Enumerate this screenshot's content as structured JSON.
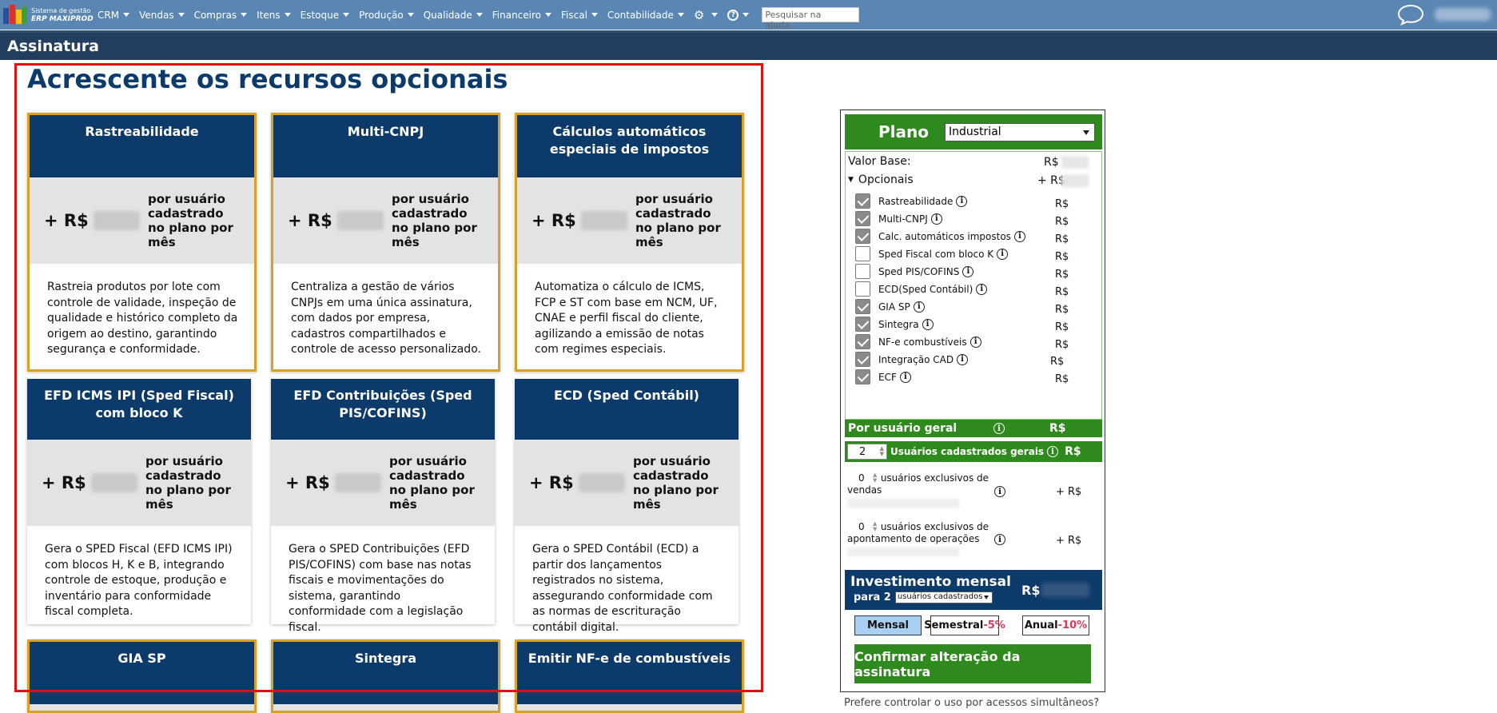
{
  "app": {
    "logo_line1": "Sistema de gestão",
    "logo_line2": "ERP MAXIPROD",
    "nav": [
      "CRM",
      "Vendas",
      "Compras",
      "Itens",
      "Estoque",
      "Produção",
      "Qualidade",
      "Financeiro",
      "Fiscal",
      "Contabilidade"
    ],
    "search_placeholder": "Pesquisar na ajuda..."
  },
  "page": {
    "title": "Assinatura",
    "section_title": "Acrescente os recursos opcionais"
  },
  "cards": [
    {
      "title": "Rastreabilidade",
      "price_prefix": "+ R$",
      "unit": "por usuário cadastrado no plano por mês",
      "desc": "Rastreia produtos por lote com controle de validade, inspeção de qualidade e histórico completo da origem ao destino, garantindo segurança e conformidade.",
      "selected": true
    },
    {
      "title": "Multi-CNPJ",
      "price_prefix": "+ R$",
      "unit": "por usuário cadastrado no plano por mês",
      "desc": "Centraliza a gestão de vários CNPJs em uma única assinatura, com dados por empresa, cadastros compartilhados e controle de acesso personalizado.",
      "selected": true
    },
    {
      "title": "Cálculos automáticos especiais de impostos",
      "price_prefix": "+ R$",
      "unit": "por usuário cadastrado no plano por mês",
      "desc": "Automatiza o cálculo de ICMS, FCP e ST com base em NCM, UF, CNAE e perfil fiscal do cliente, agilizando a emissão de notas com regimes especiais.",
      "selected": true
    },
    {
      "title": "EFD ICMS IPI (Sped Fiscal) com bloco K",
      "price_prefix": "+ R$",
      "unit": "por usuário cadastrado no plano por mês",
      "desc": "Gera o SPED Fiscal (EFD ICMS IPI) com blocos H, K e B, integrando controle de estoque, produção e inventário para conformidade fiscal completa.",
      "selected": false
    },
    {
      "title": "EFD Contribuições (Sped PIS/COFINS)",
      "price_prefix": "+ R$",
      "unit": "por usuário cadastrado no plano por mês",
      "desc": "Gera o SPED Contribuições (EFD PIS/COFINS) com base nas notas fiscais e movimentações do sistema, garantindo conformidade com a legislação fiscal.",
      "selected": false
    },
    {
      "title": "ECD (Sped Contábil)",
      "price_prefix": "+ R$",
      "unit": "por usuário cadastrado no plano por mês",
      "desc": "Gera o SPED Contábil (ECD) a partir dos lançamentos registrados no sistema, assegurando conformidade com as normas de escrituração contábil digital.",
      "selected": false
    },
    {
      "title": "GIA SP",
      "selected": true
    },
    {
      "title": "Sintegra",
      "selected": true
    },
    {
      "title": "Emitir NF-e de combustíveis",
      "selected": true
    }
  ],
  "panel": {
    "plan_label": "Plano",
    "plan_value": "Industrial",
    "valor_base": "Valor Base:",
    "rs": "R$",
    "plus_rs": "+ R$",
    "opcionais": "Opcionais",
    "options": [
      {
        "label": "Rastreabilidade",
        "checked": true
      },
      {
        "label": "Multi-CNPJ",
        "checked": true
      },
      {
        "label": "Calc. automáticos impostos",
        "checked": true
      },
      {
        "label": "Sped Fiscal com bloco K",
        "checked": false
      },
      {
        "label": "Sped PIS/COFINS",
        "checked": false
      },
      {
        "label": "ECD(Sped Contábil)",
        "checked": false
      },
      {
        "label": "GIA SP",
        "checked": true
      },
      {
        "label": "Sintegra",
        "checked": true
      },
      {
        "label": "NF-e combustíveis",
        "checked": true
      },
      {
        "label": "Integração CAD",
        "checked": true
      },
      {
        "label": "ECF",
        "checked": true
      }
    ],
    "por_usuario": "Por usuário geral",
    "users_count": "2",
    "users_label": "Usuários cadastrados gerais",
    "vendas_count": "0",
    "vendas_label1": "usuários exclusivos de",
    "vendas_label2": "vendas",
    "apont_count": "0",
    "apont_label1": "usuários exclusivos de",
    "apont_label2": "apontamento de operações",
    "invest_title": "Investimento mensal",
    "invest_para": "para 2",
    "invest_select": "usuários cadastrados",
    "periods": [
      {
        "label": "Mensal",
        "pct": ""
      },
      {
        "label": "Semestral",
        "pct": "-5%"
      },
      {
        "label": "Anual",
        "pct": "-10%"
      }
    ],
    "confirm": "Confirmar alteração da assinatura",
    "footer": "Prefere controlar o uso por acessos simultâneos?"
  },
  "colors": {
    "nav_bg": "#5a86b3",
    "title_bg": "#233f5f",
    "card_head": "#0c3a6a",
    "selected_border": "#d4a12a",
    "green": "#2f8a1e",
    "red_frame": "#e01010"
  }
}
